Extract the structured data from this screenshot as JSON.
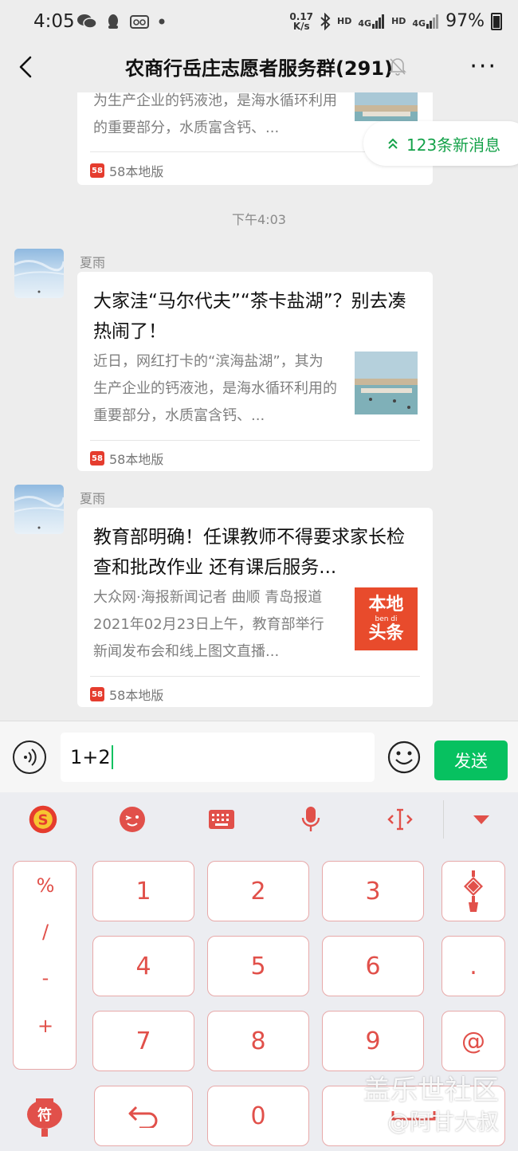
{
  "status_bar": {
    "time": "4:05",
    "speed_value": "0.17",
    "speed_unit": "K/s",
    "net1": "HD",
    "net1_type": "4G",
    "net2": "HD",
    "net2_type": "4G",
    "battery": "97%"
  },
  "nav": {
    "title": "农商行岳庄志愿者服务群(291)",
    "more": "···"
  },
  "new_messages": {
    "label": "123条新消息",
    "accent": "#15a24a"
  },
  "messages": [
    {
      "desc": "为生产企业的钙液池，是海水循环利用的重要部分，水质富含钙、...",
      "source": "58本地版"
    },
    {
      "sender": "夏雨",
      "title": "大家洼“马尔代夫”“茶卡盐湖”？别去凑热闹了！",
      "desc": "近日，网红打卡的“滨海盐湖”，其为生产企业的钙液池，是海水循环利用的重要部分，水质富含钙、...",
      "source": "58本地版"
    },
    {
      "sender": "夏雨",
      "title": "教育部明确！任课教师不得要求家长检查和批改作业 还有课后服务...",
      "desc": "大众网·海报新闻记者 曲顺 青岛报道 2021年02月23日上午，教育部举行新闻发布会和线上图文直播...",
      "source": "58本地版",
      "thumb_text_top": "本地",
      "thumb_text_mid": "ben di",
      "thumb_text_bottom": "头条"
    }
  ],
  "timestamp": "下午4:03",
  "src_logo_text": "58",
  "input": {
    "value": "1+2",
    "send_label": "发送",
    "send_color": "#07c160"
  },
  "keyboard": {
    "accent": "#e1504a",
    "symbols": [
      "%",
      "/",
      "-",
      "+"
    ],
    "digits": [
      "1",
      "2",
      "3",
      "4",
      "5",
      "6",
      "7",
      "8",
      "9",
      "0"
    ],
    "dot": ".",
    "at": "@",
    "fu": "符"
  },
  "watermark": {
    "line1": "盖乐世社区",
    "line2": "@阿甘大叔"
  }
}
